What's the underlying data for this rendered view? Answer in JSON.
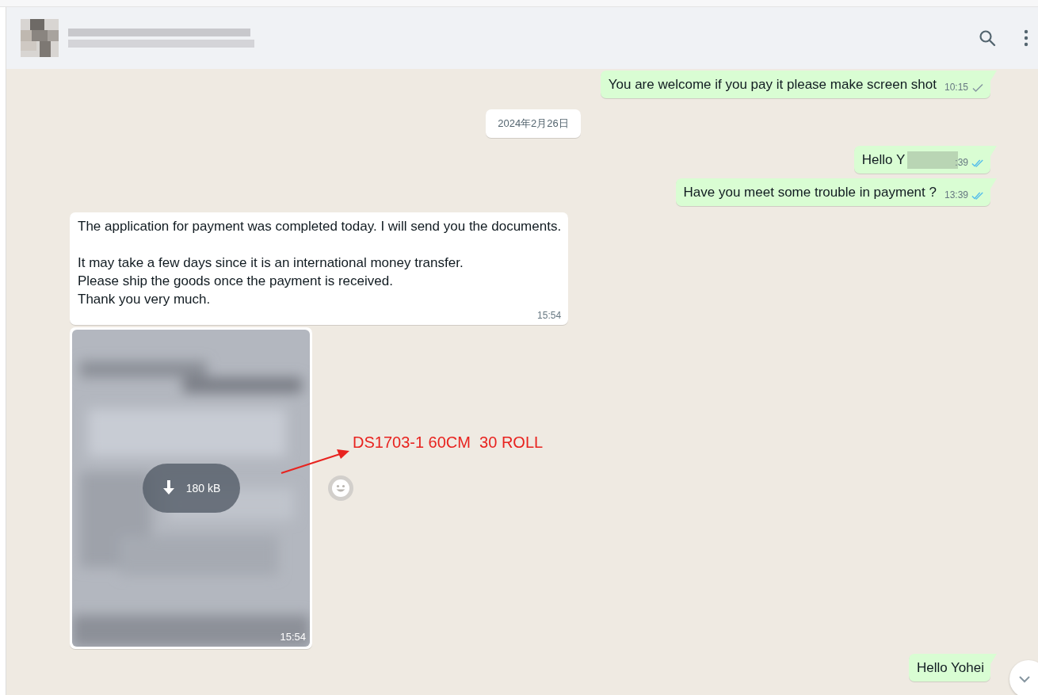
{
  "header": {
    "redacted": true
  },
  "messages": [
    {
      "kind": "text",
      "outgoing": true,
      "paragraphs": [
        "You are welcome if you pay it please make screen shot"
      ],
      "time": "10:15",
      "sent": true,
      "read": false
    },
    {
      "kind": "date",
      "label": "2024年2月26日"
    },
    {
      "kind": "text",
      "outgoing": true,
      "paragraphs": [
        "Hello Y"
      ],
      "time": ":39",
      "sent": true,
      "read": true,
      "redacted": true
    },
    {
      "kind": "text",
      "outgoing": true,
      "paragraphs": [
        "Have you meet some trouble in payment ?"
      ],
      "time": "13:39",
      "sent": true,
      "read": true
    },
    {
      "kind": "text",
      "outgoing": false,
      "paragraphs": [
        "The application for payment was completed today. I will send you the documents.",
        "It may take a few days since it is an international money transfer.\nPlease ship the goods once the payment is received.\nThank you very much."
      ],
      "time": "15:54"
    },
    {
      "outgoing": false,
      "size": "180 kB",
      "time": "15:54"
    },
    {
      "kind": "text",
      "outgoing": true,
      "paragraphs": [
        "Hello Yohei"
      ]
    }
  ],
  "annotation": {
    "text": "DS1703-1 60CM  30 ROLL",
    "color": "#e8231f"
  }
}
